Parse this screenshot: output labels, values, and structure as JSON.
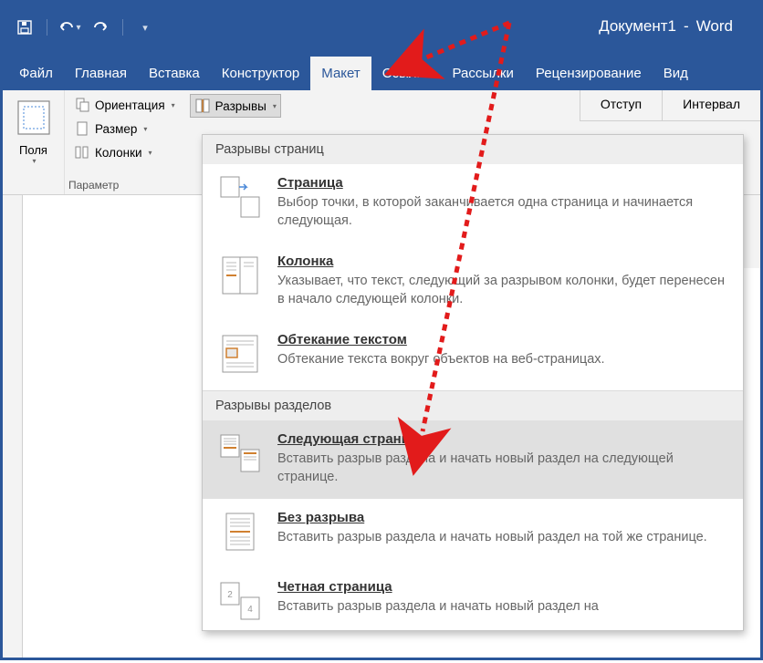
{
  "titlebar": {
    "doc_name": "Документ1",
    "app_name": "Word"
  },
  "tabs": {
    "file": "Файл",
    "home": "Главная",
    "insert": "Вставка",
    "design": "Конструктор",
    "layout": "Макет",
    "references": "Ссылки",
    "mailings": "Рассылки",
    "review": "Рецензирование",
    "view": "Вид"
  },
  "ribbon": {
    "margins": "Поля",
    "orientation": "Ориентация",
    "size": "Размер",
    "columns": "Колонки",
    "breaks": "Разрывы",
    "group_params": "Параметр",
    "indent": "Отступ",
    "spacing": "Интервал"
  },
  "dropdown": {
    "section1": "Разрывы страниц",
    "page_t": "Страница",
    "page_d": "Выбор точки, в которой заканчивается одна страница и начинается следующая.",
    "col_t": "Колонка",
    "col_d": "Указывает, что текст, следующий за разрывом колонки, будет перенесен в начало следующей колонки.",
    "wrap_t": "Обтекание текстом",
    "wrap_d": "Обтекание текста вокруг объектов на веб-страницах.",
    "section2": "Разрывы разделов",
    "next_t": "Следующая страница",
    "next_d": "Вставить разрыв раздела и начать новый раздел на следующей странице.",
    "cont_t": "Без разрыва",
    "cont_d": "Вставить разрыв раздела и начать новый раздел на той же странице.",
    "even_t": "Четная страница",
    "even_d": "Вставить разрыв раздела и начать новый раздел на"
  }
}
